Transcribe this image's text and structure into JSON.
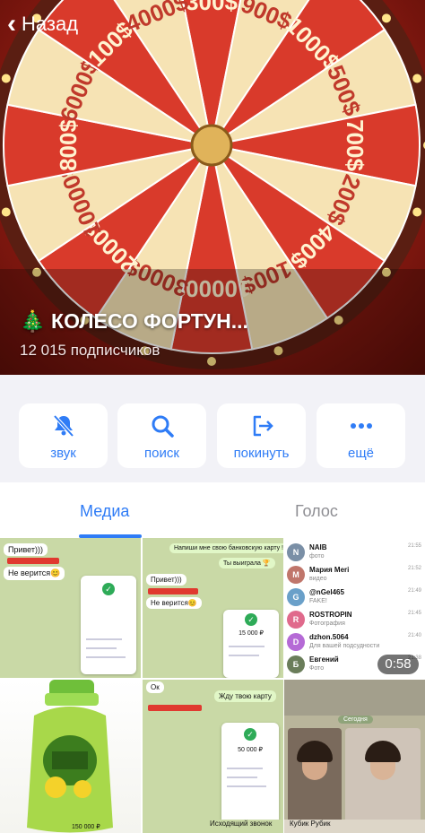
{
  "nav": {
    "back_label": "Назад"
  },
  "channel": {
    "title": "🎄 КОЛЕСО ФОРТУН...",
    "subscribers": "12 015 подписчиков"
  },
  "wheel": {
    "segments": [
      "300$",
      "900$",
      "1000$",
      "500$",
      "700$",
      "200$",
      "400$",
      "100$",
      "10000$",
      "3000$",
      "2000$",
      "10000$",
      "800$",
      "6000$",
      "100$",
      "4000$"
    ],
    "colors": {
      "red": "#d93a2b",
      "cream": "#f6e3b4",
      "rim": "#5a1e12",
      "hub": "#e0b35a"
    }
  },
  "actions": [
    {
      "label": "звук",
      "icon": "bell-slash-icon"
    },
    {
      "label": "поиск",
      "icon": "search-icon"
    },
    {
      "label": "покинуть",
      "icon": "leave-icon"
    },
    {
      "label": "ещё",
      "icon": "more-dots-icon"
    }
  ],
  "tabs": [
    {
      "label": "Медиа",
      "active": true
    },
    {
      "label": "Голос",
      "active": false
    }
  ],
  "accent": "#2f7cf6",
  "media": {
    "thumb1": {
      "b1": "Привет)))",
      "b2": "Не верится😊"
    },
    "thumb2": {
      "b1": "Напиши мне свою банковскую карту !!!!",
      "b2": "Ты выиграла 🏆",
      "b3": "Привет)))",
      "b4": "Не верится😊",
      "amount": "15 000 ₽"
    },
    "thumb3": {
      "contacts": [
        {
          "initial": "N",
          "name": "NAIB",
          "msg": "фото",
          "time": "21:55",
          "color": "#7a8fa6"
        },
        {
          "initial": "М",
          "name": "Мария Мeri",
          "msg": "видео",
          "time": "21:52",
          "color": "#c0766b"
        },
        {
          "initial": "G",
          "name": "@nGel465",
          "msg": "FAKE!",
          "time": "21:49",
          "color": "#6aa0c9"
        },
        {
          "initial": "R",
          "name": "ROSTROPIN",
          "msg": "Фотография",
          "time": "21:45",
          "color": "#e06a8c"
        },
        {
          "initial": "D",
          "name": "dzhon.5064",
          "msg": "Для вашей подсудности",
          "time": "21:40",
          "color": "#b56ad6"
        },
        {
          "initial": "Б",
          "name": "Евгений",
          "msg": "Фото",
          "time": "21:38",
          "color": "#6a7d5a"
        }
      ]
    },
    "video_duration": "0:58",
    "thumb5": {
      "b1": "Ок",
      "b2": "Жду твою карту",
      "amount": "50 000 ₽"
    },
    "thumb6": {
      "date": "Сегодня"
    },
    "thumb7": {
      "caption": "Исходящий звонок"
    },
    "thumb8": {
      "caption": "Кубик Рубик"
    },
    "thumb9": {
      "amount": "150 000 ₽"
    }
  }
}
